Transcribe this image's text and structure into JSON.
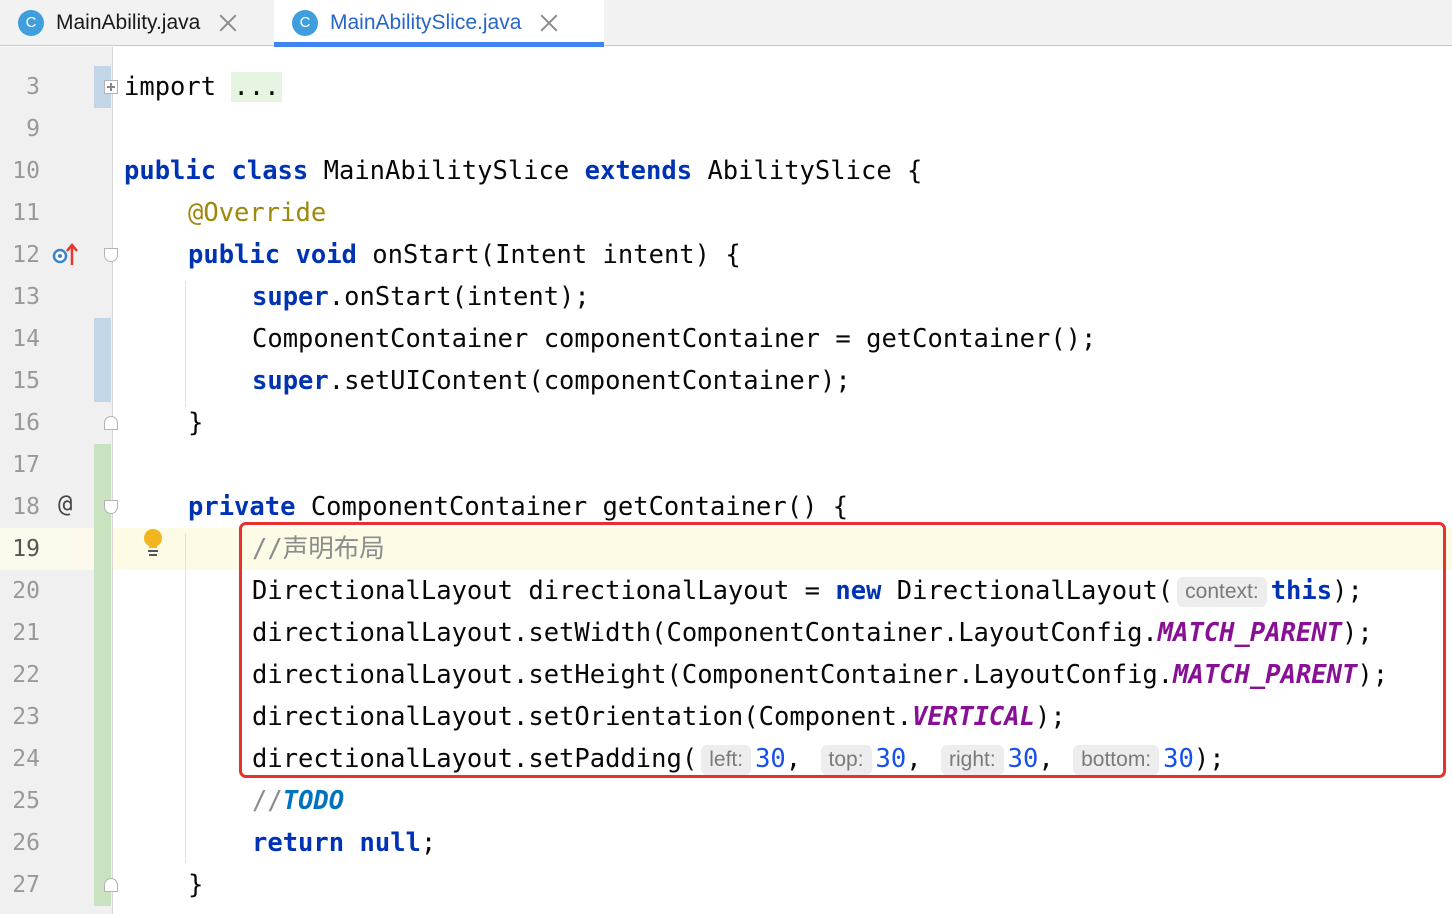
{
  "tabs": [
    {
      "icon": "C",
      "label": "MainAbility.java",
      "active": false
    },
    {
      "icon": "C",
      "label": "MainAbilitySlice.java",
      "active": true
    }
  ],
  "gutter": {
    "line_numbers": [
      "3",
      "9",
      "10",
      "11",
      "12",
      "13",
      "14",
      "15",
      "16",
      "17",
      "18",
      "19",
      "20",
      "21",
      "22",
      "23",
      "24",
      "25",
      "26",
      "27"
    ],
    "current_line": "19",
    "implements_marker": "@"
  },
  "code": {
    "l3_kw": "import",
    "l3_folded": "...",
    "l10_kw1": "public",
    "l10_kw2": "class",
    "l10_name": "MainAbilitySlice",
    "l10_kw3": "extends",
    "l10_rest": "AbilitySlice {",
    "l11_ann": "@Override",
    "l12_kw1": "public",
    "l12_kw2": "void",
    "l12_rest": "onStart(Intent intent) {",
    "l13_kw": "super",
    "l13_rest": ".onStart(intent);",
    "l14_text": "ComponentContainer componentContainer = getContainer();",
    "l15_kw": "super",
    "l15_rest": ".setUIContent(componentContainer);",
    "l16_text": "}",
    "l18_kw": "private",
    "l18_rest": "ComponentContainer getContainer() {",
    "l19_cmt": "//声明布局",
    "l20_a": "DirectionalLayout directionalLayout = ",
    "l20_kw": "new",
    "l20_b": " DirectionalLayout(",
    "l20_hint": "context:",
    "l20_this": "this",
    "l20_c": ");",
    "l21_a": "directionalLayout.setWidth(ComponentContainer.LayoutConfig.",
    "l21_const": "MATCH_PARENT",
    "l21_b": ");",
    "l22_a": "directionalLayout.setHeight(ComponentContainer.LayoutConfig.",
    "l22_const": "MATCH_PARENT",
    "l22_b": ");",
    "l23_a": "directionalLayout.setOrientation(Component.",
    "l23_const": "VERTICAL",
    "l23_b": ");",
    "l24_a": "directionalLayout.setPadding(",
    "l24_h1": "left:",
    "l24_v1": "30",
    "l24_h2": "top:",
    "l24_v2": "30",
    "l24_h3": "right:",
    "l24_v3": "30",
    "l24_h4": "bottom:",
    "l24_v4": "30",
    "comma": ",",
    "l24_end": ");",
    "l25_cmt": "//",
    "l25_todo": "TODO",
    "l26_kw1": "return",
    "l26_kw2": "null",
    "l26_rest": ";",
    "l27_text": "}"
  },
  "colors": {
    "keyword": "#0033b3",
    "annotation": "#9e880d",
    "constant": "#871094",
    "number": "#1750eb",
    "highlight_box": "#e8302c",
    "active_tab_accent": "#4083f6"
  }
}
